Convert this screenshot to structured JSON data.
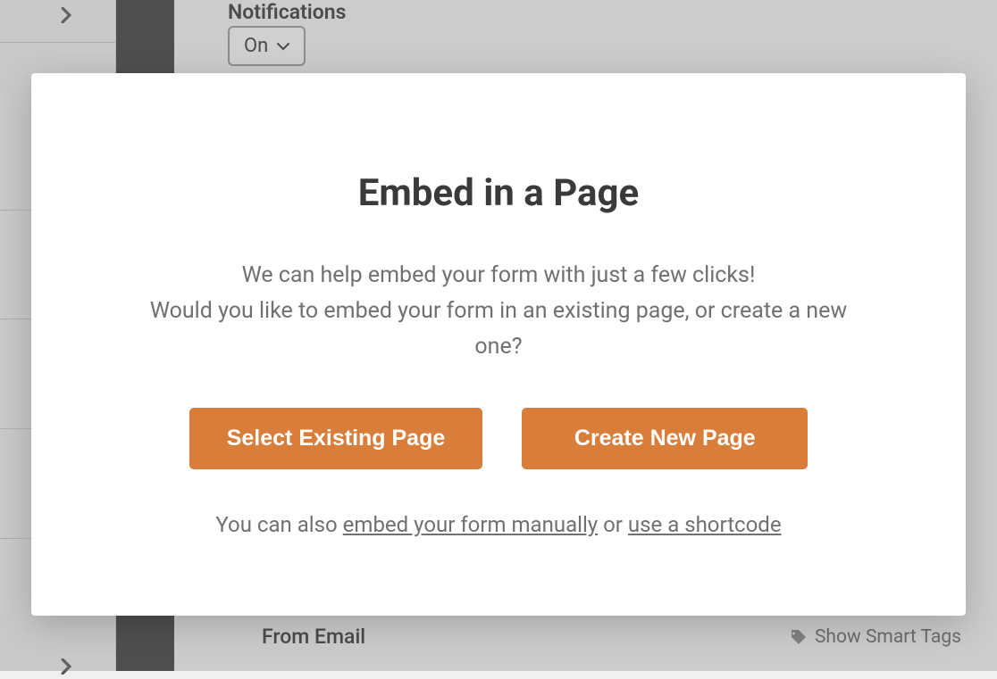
{
  "background": {
    "notifications_label": "Notifications",
    "on_dropdown_value": "On",
    "from_email_label": "From Email",
    "smart_tags_label": "Show Smart Tags"
  },
  "modal": {
    "title": "Embed in a Page",
    "description_line1": "We can help embed your form with just a few clicks!",
    "description_line2": "Would you like to embed your form in an existing page, or create a new one?",
    "select_existing_label": "Select Existing Page",
    "create_new_label": "Create New Page",
    "footer_prefix": "You can also ",
    "footer_link1": "embed your form manually",
    "footer_middle": " or ",
    "footer_link2": "use a shortcode"
  }
}
